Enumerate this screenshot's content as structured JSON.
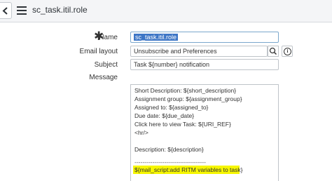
{
  "header": {
    "title": "sc_task.itil.role"
  },
  "form": {
    "name_label": "Name",
    "name_value": "sc_task.itil.role",
    "email_layout_label": "Email layout",
    "email_layout_value": "Unsubscribe and Preferences",
    "subject_label": "Subject",
    "subject_value": "Task ${number} notification",
    "message_label": "Message",
    "message_lines": [
      "Short Description: ${short_description}",
      "Assignment group: ${assignment_group}",
      "Assigned to: ${assigned_to}",
      "Due date: ${due_date}",
      "Click here to view Task: ${URI_REF}",
      "<hr/>",
      "",
      "Description: ${description}",
      "",
      "------------------------------------",
      "${mail_script:add RITM variables to task}"
    ]
  },
  "colors": {
    "highlight": "#f6f600",
    "selection": "#3d76c6"
  },
  "icons": [
    "back-arrow-icon",
    "hamburger-menu-icon",
    "required-asterisk-icon",
    "search-icon",
    "info-icon"
  ]
}
